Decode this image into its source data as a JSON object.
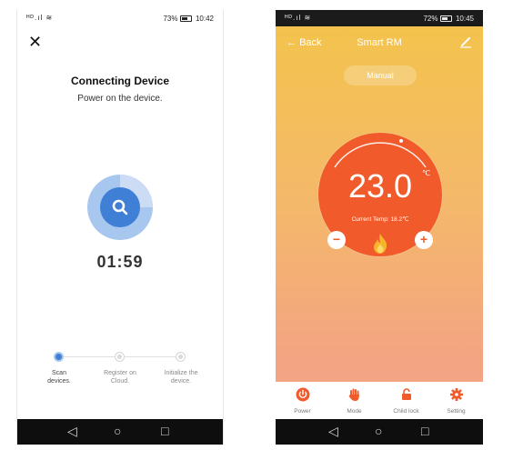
{
  "screen_left": {
    "status": {
      "signal": "ᴴᴰ.ıl ≋",
      "battery_text": "73%",
      "time": "10:42"
    },
    "close_icon": "close-icon",
    "title": "Connecting Device",
    "subtitle": "Power on the device.",
    "timer": "01:59",
    "steps": [
      {
        "label_line1": "Scan",
        "label_line2": "devices.",
        "state": "active"
      },
      {
        "label_line1": "Register on",
        "label_line2": "Cloud.",
        "state": "pending"
      },
      {
        "label_line1": "Initialize the",
        "label_line2": "device.",
        "state": "pending"
      }
    ],
    "nav": {
      "back": "◁",
      "home": "○",
      "recent": "□"
    }
  },
  "screen_right": {
    "status": {
      "signal": "ᴴᴰ.ıl ≋",
      "battery_text": "72%",
      "time": "10:45"
    },
    "header": {
      "back_label": "Back",
      "back_arrow": "←",
      "title": "Smart RM"
    },
    "mode_pill": "Manual",
    "thermostat": {
      "set_temp": "23.0",
      "unit": "℃",
      "current_temp": "Current Temp: 18.2℃",
      "minus": "−",
      "plus": "+"
    },
    "tabs": [
      {
        "label": "Power",
        "icon": "power-icon"
      },
      {
        "label": "Mode",
        "icon": "hand-icon"
      },
      {
        "label": "Child lock",
        "icon": "lock-icon"
      },
      {
        "label": "Setting",
        "icon": "gear-icon"
      }
    ],
    "nav": {
      "back": "◁",
      "home": "○",
      "recent": "□"
    }
  },
  "colors": {
    "accent_blue": "#3f7fd6",
    "accent_orange": "#f15a2a",
    "gradient_top": "#f3c44a",
    "gradient_bottom": "#f1a38a"
  }
}
